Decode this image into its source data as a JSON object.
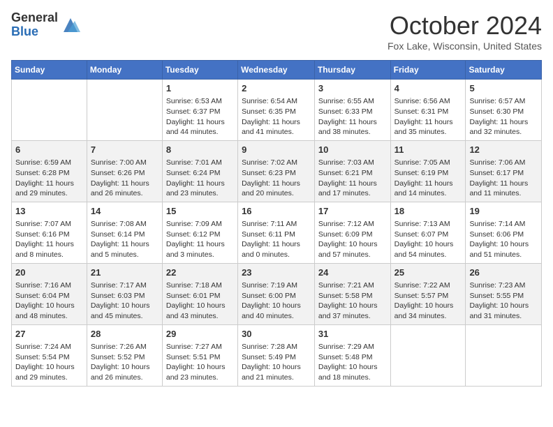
{
  "header": {
    "logo_general": "General",
    "logo_blue": "Blue",
    "month_title": "October 2024",
    "location": "Fox Lake, Wisconsin, United States"
  },
  "days_of_week": [
    "Sunday",
    "Monday",
    "Tuesday",
    "Wednesday",
    "Thursday",
    "Friday",
    "Saturday"
  ],
  "weeks": [
    [
      {
        "day": "",
        "info": ""
      },
      {
        "day": "",
        "info": ""
      },
      {
        "day": "1",
        "info": "Sunrise: 6:53 AM\nSunset: 6:37 PM\nDaylight: 11 hours and 44 minutes."
      },
      {
        "day": "2",
        "info": "Sunrise: 6:54 AM\nSunset: 6:35 PM\nDaylight: 11 hours and 41 minutes."
      },
      {
        "day": "3",
        "info": "Sunrise: 6:55 AM\nSunset: 6:33 PM\nDaylight: 11 hours and 38 minutes."
      },
      {
        "day": "4",
        "info": "Sunrise: 6:56 AM\nSunset: 6:31 PM\nDaylight: 11 hours and 35 minutes."
      },
      {
        "day": "5",
        "info": "Sunrise: 6:57 AM\nSunset: 6:30 PM\nDaylight: 11 hours and 32 minutes."
      }
    ],
    [
      {
        "day": "6",
        "info": "Sunrise: 6:59 AM\nSunset: 6:28 PM\nDaylight: 11 hours and 29 minutes."
      },
      {
        "day": "7",
        "info": "Sunrise: 7:00 AM\nSunset: 6:26 PM\nDaylight: 11 hours and 26 minutes."
      },
      {
        "day": "8",
        "info": "Sunrise: 7:01 AM\nSunset: 6:24 PM\nDaylight: 11 hours and 23 minutes."
      },
      {
        "day": "9",
        "info": "Sunrise: 7:02 AM\nSunset: 6:23 PM\nDaylight: 11 hours and 20 minutes."
      },
      {
        "day": "10",
        "info": "Sunrise: 7:03 AM\nSunset: 6:21 PM\nDaylight: 11 hours and 17 minutes."
      },
      {
        "day": "11",
        "info": "Sunrise: 7:05 AM\nSunset: 6:19 PM\nDaylight: 11 hours and 14 minutes."
      },
      {
        "day": "12",
        "info": "Sunrise: 7:06 AM\nSunset: 6:17 PM\nDaylight: 11 hours and 11 minutes."
      }
    ],
    [
      {
        "day": "13",
        "info": "Sunrise: 7:07 AM\nSunset: 6:16 PM\nDaylight: 11 hours and 8 minutes."
      },
      {
        "day": "14",
        "info": "Sunrise: 7:08 AM\nSunset: 6:14 PM\nDaylight: 11 hours and 5 minutes."
      },
      {
        "day": "15",
        "info": "Sunrise: 7:09 AM\nSunset: 6:12 PM\nDaylight: 11 hours and 3 minutes."
      },
      {
        "day": "16",
        "info": "Sunrise: 7:11 AM\nSunset: 6:11 PM\nDaylight: 11 hours and 0 minutes."
      },
      {
        "day": "17",
        "info": "Sunrise: 7:12 AM\nSunset: 6:09 PM\nDaylight: 10 hours and 57 minutes."
      },
      {
        "day": "18",
        "info": "Sunrise: 7:13 AM\nSunset: 6:07 PM\nDaylight: 10 hours and 54 minutes."
      },
      {
        "day": "19",
        "info": "Sunrise: 7:14 AM\nSunset: 6:06 PM\nDaylight: 10 hours and 51 minutes."
      }
    ],
    [
      {
        "day": "20",
        "info": "Sunrise: 7:16 AM\nSunset: 6:04 PM\nDaylight: 10 hours and 48 minutes."
      },
      {
        "day": "21",
        "info": "Sunrise: 7:17 AM\nSunset: 6:03 PM\nDaylight: 10 hours and 45 minutes."
      },
      {
        "day": "22",
        "info": "Sunrise: 7:18 AM\nSunset: 6:01 PM\nDaylight: 10 hours and 43 minutes."
      },
      {
        "day": "23",
        "info": "Sunrise: 7:19 AM\nSunset: 6:00 PM\nDaylight: 10 hours and 40 minutes."
      },
      {
        "day": "24",
        "info": "Sunrise: 7:21 AM\nSunset: 5:58 PM\nDaylight: 10 hours and 37 minutes."
      },
      {
        "day": "25",
        "info": "Sunrise: 7:22 AM\nSunset: 5:57 PM\nDaylight: 10 hours and 34 minutes."
      },
      {
        "day": "26",
        "info": "Sunrise: 7:23 AM\nSunset: 5:55 PM\nDaylight: 10 hours and 31 minutes."
      }
    ],
    [
      {
        "day": "27",
        "info": "Sunrise: 7:24 AM\nSunset: 5:54 PM\nDaylight: 10 hours and 29 minutes."
      },
      {
        "day": "28",
        "info": "Sunrise: 7:26 AM\nSunset: 5:52 PM\nDaylight: 10 hours and 26 minutes."
      },
      {
        "day": "29",
        "info": "Sunrise: 7:27 AM\nSunset: 5:51 PM\nDaylight: 10 hours and 23 minutes."
      },
      {
        "day": "30",
        "info": "Sunrise: 7:28 AM\nSunset: 5:49 PM\nDaylight: 10 hours and 21 minutes."
      },
      {
        "day": "31",
        "info": "Sunrise: 7:29 AM\nSunset: 5:48 PM\nDaylight: 10 hours and 18 minutes."
      },
      {
        "day": "",
        "info": ""
      },
      {
        "day": "",
        "info": ""
      }
    ]
  ]
}
